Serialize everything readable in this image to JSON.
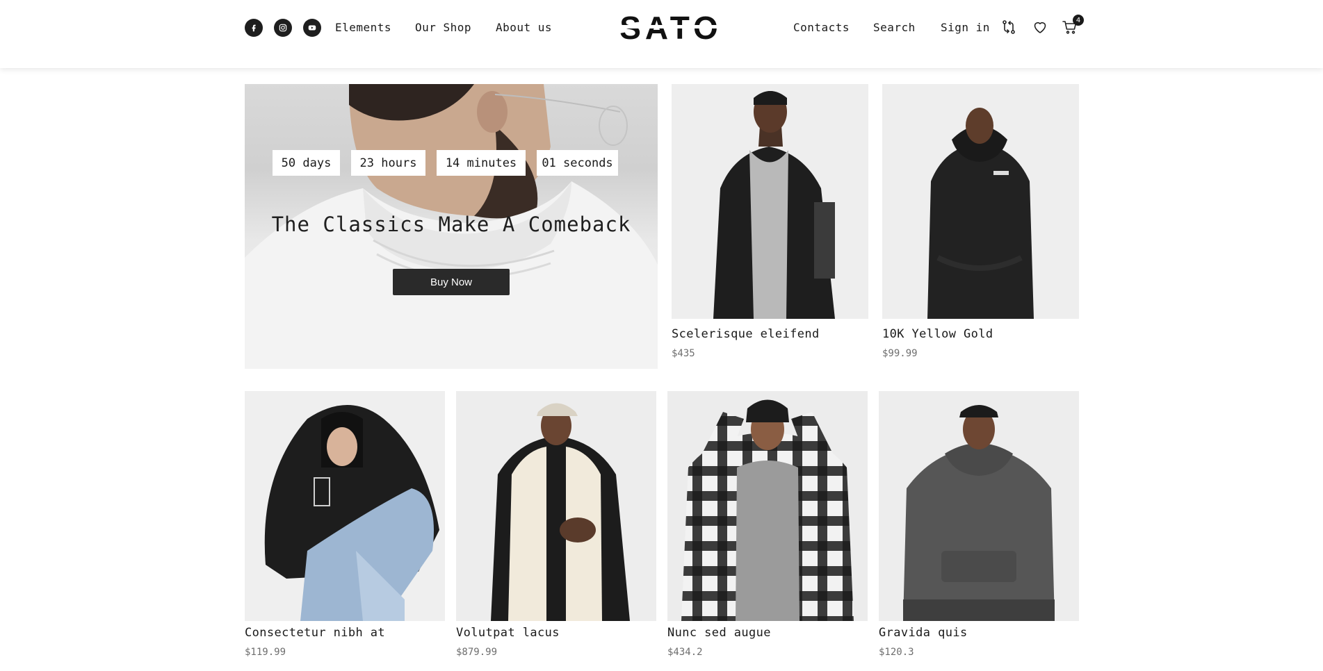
{
  "header": {
    "social": [
      {
        "name": "facebook-icon"
      },
      {
        "name": "instagram-icon"
      },
      {
        "name": "youtube-icon"
      }
    ],
    "nav_left": [
      "Elements",
      "Our Shop",
      "About us"
    ],
    "logo_text": "SATO",
    "nav_right": [
      "Contacts",
      "Search",
      "Sign in"
    ],
    "icons": [
      "compare-icon",
      "heart-icon",
      "cart-icon"
    ],
    "cart_count": "4"
  },
  "hero": {
    "countdown": [
      "50 days",
      "23 hours",
      "14 minutes",
      "01 seconds"
    ],
    "title": "The Classics Make A Comeback",
    "button": "Buy Now"
  },
  "products": {
    "top": [
      {
        "name": "Scelerisque eleifend",
        "price": "$435"
      },
      {
        "name": "10K Yellow Gold",
        "price": "$99.99"
      }
    ],
    "bottom": [
      {
        "name": "Consectetur nibh at",
        "price": "$119.99"
      },
      {
        "name": "Volutpat lacus",
        "price": "$879.99"
      },
      {
        "name": "Nunc sed augue",
        "price": "$434.2"
      },
      {
        "name": "Gravida quis",
        "price": "$120.3"
      }
    ]
  },
  "colors": {
    "text": "#1a1a1a",
    "price": "#6e6e6e",
    "button": "#2a2a2a",
    "photo_bg": "#eeeeee"
  }
}
